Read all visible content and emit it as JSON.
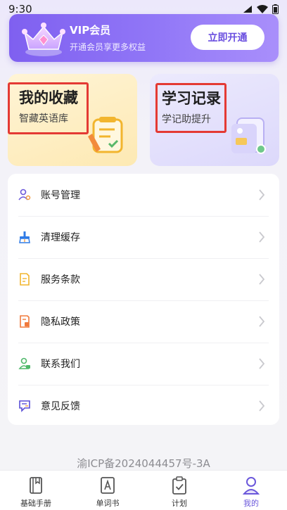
{
  "status_bar": {
    "time": "9:30"
  },
  "vip": {
    "title": "VIP会员",
    "subtitle": "开通会员享更多权益",
    "button_label": "立即开通"
  },
  "cards": {
    "favorites": {
      "title": "我的收藏",
      "subtitle": "智藏英语库"
    },
    "records": {
      "title": "学习记录",
      "subtitle": "学记助提升"
    }
  },
  "menu": {
    "items": [
      {
        "label": "账号管理",
        "icon": "account-icon"
      },
      {
        "label": "清理缓存",
        "icon": "broom-icon"
      },
      {
        "label": "服务条款",
        "icon": "document-icon"
      },
      {
        "label": "隐私政策",
        "icon": "privacy-icon"
      },
      {
        "label": "联系我们",
        "icon": "contact-icon"
      },
      {
        "label": "意见反馈",
        "icon": "feedback-icon"
      }
    ]
  },
  "footer": {
    "icp": "渝ICP备2024044457号-3A"
  },
  "tabbar": {
    "tabs": [
      {
        "label": "基础手册",
        "icon": "book-icon"
      },
      {
        "label": "单词书",
        "icon": "letter-a-icon"
      },
      {
        "label": "计划",
        "icon": "clipboard-check-icon"
      },
      {
        "label": "我的",
        "icon": "person-icon"
      }
    ],
    "active_index": 3
  },
  "colors": {
    "accent": "#6b58db",
    "vip_gradient_start": "#7f60f0",
    "vip_gradient_end": "#a98ffb",
    "highlight_border": "#e43a34"
  }
}
